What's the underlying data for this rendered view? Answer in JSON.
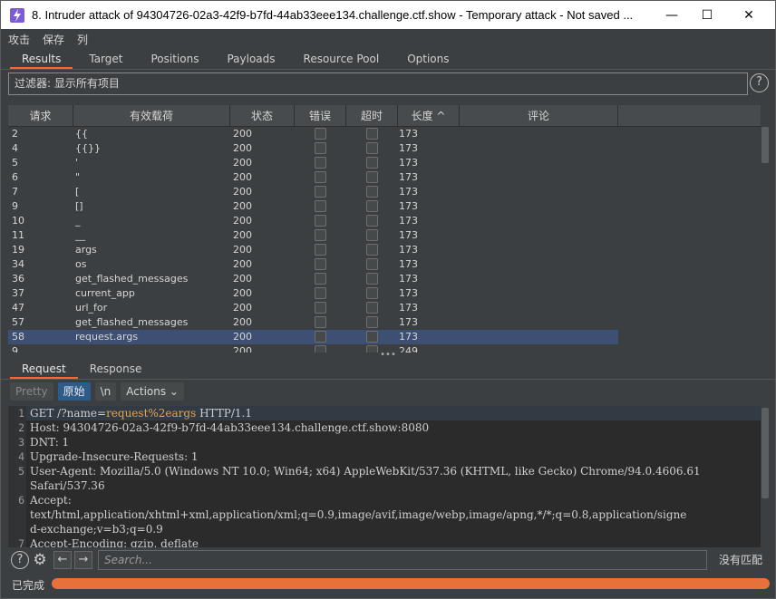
{
  "window": {
    "title": "8. Intruder attack of 94304726-02a3-42f9-b7fd-44ab33eee134.challenge.ctf.show - Temporary attack - Not saved ...",
    "minimize": "—",
    "maximize": "☐",
    "close": "✕"
  },
  "menu": [
    "攻击",
    "保存",
    "列"
  ],
  "tabs": [
    "Results",
    "Target",
    "Positions",
    "Payloads",
    "Resource Pool",
    "Options"
  ],
  "filter": {
    "label": "过滤器: 显示所有项目",
    "help": "?"
  },
  "table": {
    "columns": [
      "请求",
      "有效载荷",
      "状态",
      "错误",
      "超时",
      "长度 ^",
      "评论"
    ],
    "rows": [
      {
        "req": "2",
        "payload": "{{",
        "status": "200",
        "length": "173"
      },
      {
        "req": "4",
        "payload": "{{}}",
        "status": "200",
        "length": "173"
      },
      {
        "req": "5",
        "payload": "'",
        "status": "200",
        "length": "173"
      },
      {
        "req": "6",
        "payload": "\"",
        "status": "200",
        "length": "173"
      },
      {
        "req": "7",
        "payload": "[",
        "status": "200",
        "length": "173"
      },
      {
        "req": "9",
        "payload": "[]",
        "status": "200",
        "length": "173"
      },
      {
        "req": "10",
        "payload": "_",
        "status": "200",
        "length": "173"
      },
      {
        "req": "11",
        "payload": "__",
        "status": "200",
        "length": "173"
      },
      {
        "req": "19",
        "payload": "args",
        "status": "200",
        "length": "173"
      },
      {
        "req": "34",
        "payload": "os",
        "status": "200",
        "length": "173"
      },
      {
        "req": "36",
        "payload": "get_flashed_messages",
        "status": "200",
        "length": "173"
      },
      {
        "req": "37",
        "payload": "current_app",
        "status": "200",
        "length": "173"
      },
      {
        "req": "47",
        "payload": "url_for",
        "status": "200",
        "length": "173"
      },
      {
        "req": "57",
        "payload": "get_flashed_messages",
        "status": "200",
        "length": "173"
      },
      {
        "req": "58",
        "payload": "request.args",
        "status": "200",
        "length": "173"
      },
      {
        "req": "9",
        "payload": "",
        "status": "200",
        "length": "249"
      }
    ],
    "selected_index": 14
  },
  "request_tabs": [
    "Request",
    "Response"
  ],
  "editor_toolbar": {
    "pretty": "Pretty",
    "raw": "原始",
    "newline": "\\n",
    "actions": "Actions ⌄"
  },
  "editor": {
    "line1": {
      "num": "1",
      "method": "GET /?name=",
      "param": "request%2eargs",
      "rest": " HTTP/1.1"
    },
    "lines": [
      {
        "num": "2",
        "text": "Host: 94304726-02a3-42f9-b7fd-44ab33eee134.challenge.ctf.show:8080"
      },
      {
        "num": "3",
        "text": "DNT: 1"
      },
      {
        "num": "4",
        "text": "Upgrade-Insecure-Requests: 1"
      },
      {
        "num": "5",
        "text": "User-Agent: Mozilla/5.0 (Windows NT 10.0; Win64; x64) AppleWebKit/537.36 (KHTML, like Gecko) Chrome/94.0.4606.61"
      },
      {
        "num": "",
        "text": "Safari/537.36"
      },
      {
        "num": "6",
        "text": "Accept:"
      },
      {
        "num": "",
        "text": "text/html,application/xhtml+xml,application/xml;q=0.9,image/avif,image/webp,image/apng,*/*;q=0.8,application/signe"
      },
      {
        "num": "",
        "text": "d-exchange;v=b3;q=0.9"
      },
      {
        "num": "7",
        "text": "Accept-Encoding: gzip, deflate"
      }
    ]
  },
  "bottom": {
    "search_placeholder": "Search...",
    "no_match": "没有匹配",
    "help": "?",
    "prev": "←",
    "next": "→"
  },
  "status": {
    "text": "已完成",
    "progress": 1.0
  }
}
